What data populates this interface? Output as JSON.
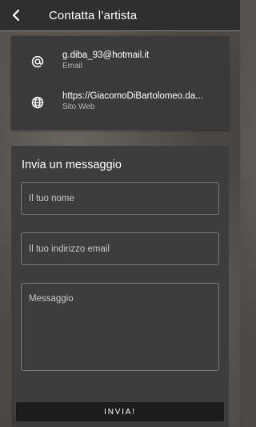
{
  "header": {
    "title": "Contatta l’artista",
    "back_icon": "chevron-left-icon"
  },
  "contact": {
    "email": {
      "value": "g.diba_93@hotmail.it",
      "label": "Email",
      "icon": "at-icon"
    },
    "website": {
      "value": "https://GiacomoDiBartolomeo.da...",
      "label": "Sito Web",
      "icon": "globe-icon"
    }
  },
  "form": {
    "title": "Invia un messaggio",
    "name_placeholder": "Il tuo nome",
    "email_placeholder": "Il tuo indirizzo email",
    "message_placeholder": "Messaggio",
    "submit_label": "INVIA!"
  },
  "colors": {
    "header_bg": "#2f2f2f",
    "card_bg": "#3a3a3a",
    "panel_bg": "#3d3d3d",
    "button_bg": "#1c1c1c"
  }
}
